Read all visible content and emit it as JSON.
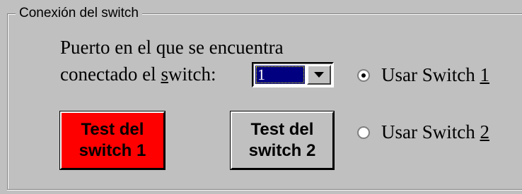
{
  "group": {
    "title": "Conexión del switch"
  },
  "port": {
    "prompt_line1": "Puerto en el que se encuentra",
    "prompt_line2_pre": "conectado el ",
    "prompt_line2_mnemonic": "s",
    "prompt_line2_post": "witch:",
    "selected": "1"
  },
  "buttons": {
    "test1_line1": "Test del",
    "test1_line2": "switch 1",
    "test1_color": "#ff0000",
    "test2_line1": "Test del",
    "test2_line2": "switch 2",
    "test2_color": "#c0c0c0"
  },
  "radios": {
    "switch1_label": "Usar Switch ",
    "switch1_mnemonic": "1",
    "switch1_checked": true,
    "switch2_label": "Usar Switch ",
    "switch2_mnemonic": "2",
    "switch2_checked": false
  }
}
